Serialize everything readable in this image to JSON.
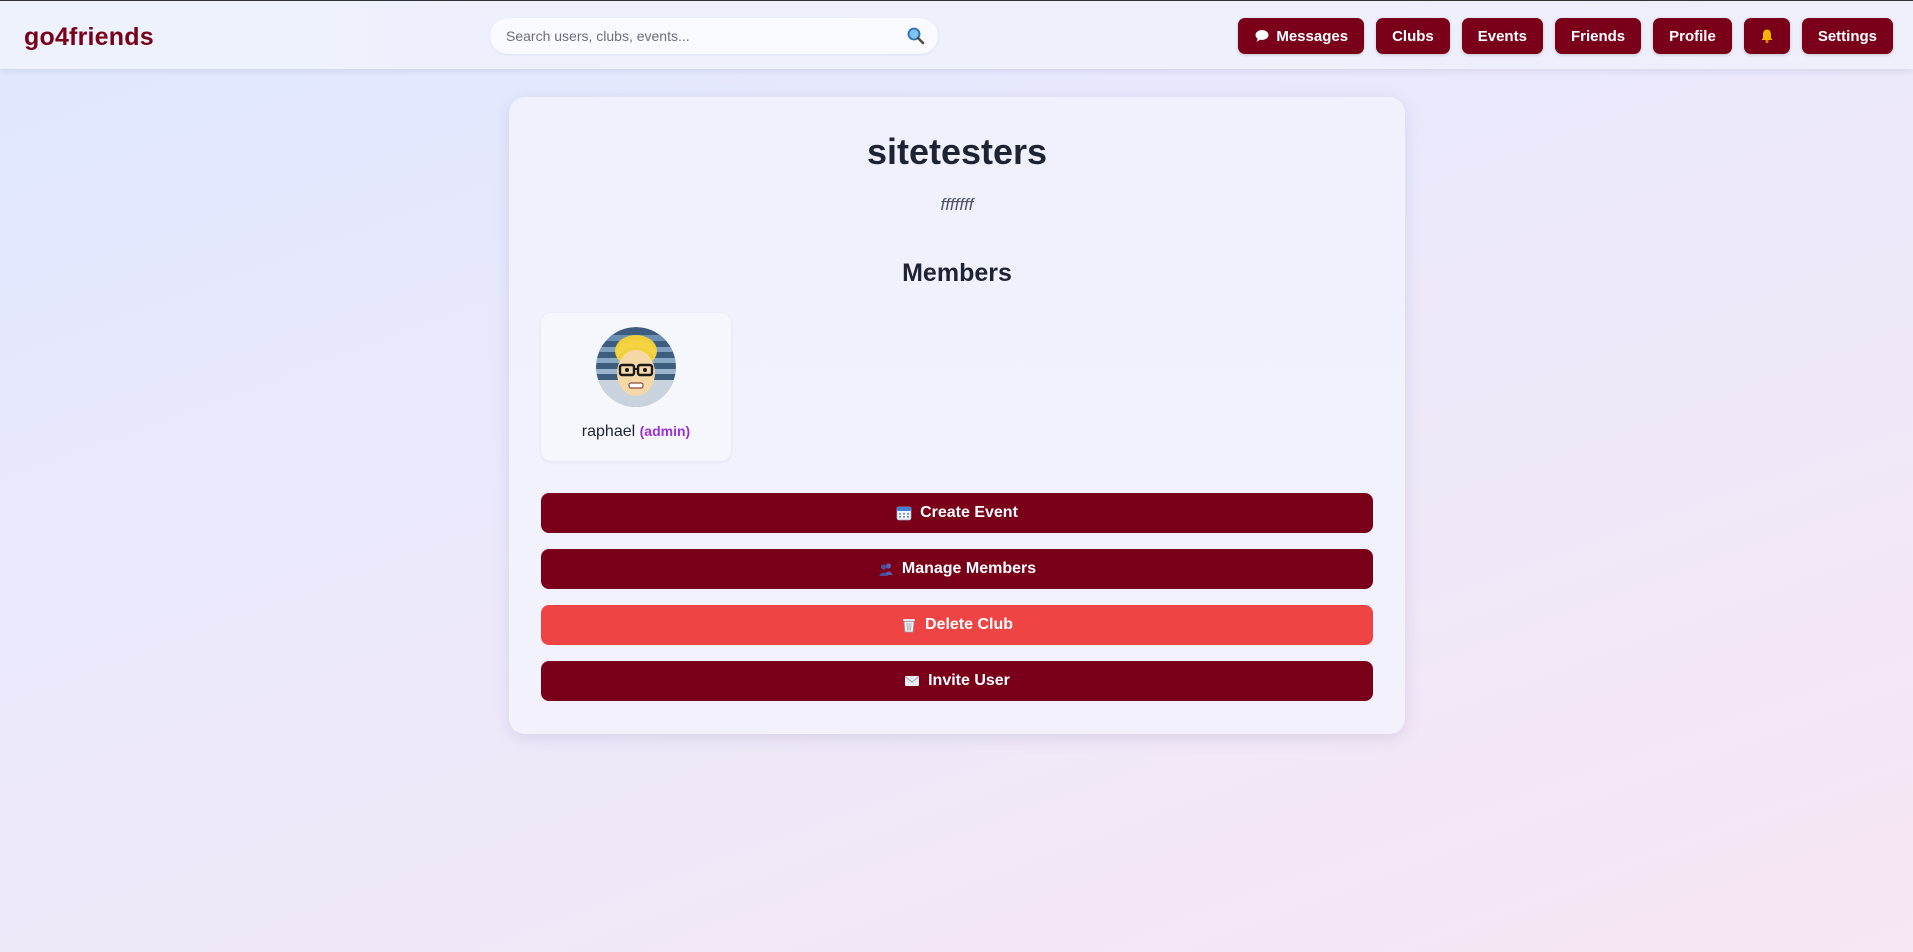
{
  "header": {
    "brand": "go4friends",
    "search_placeholder": "Search users, clubs, events...",
    "nav": [
      {
        "label": "Messages",
        "icon": "speech-bubble-icon"
      },
      {
        "label": "Clubs"
      },
      {
        "label": "Events"
      },
      {
        "label": "Friends"
      },
      {
        "label": "Profile"
      },
      {
        "label": "",
        "icon": "bell-icon"
      },
      {
        "label": "Settings"
      }
    ]
  },
  "club": {
    "name": "sitetesters",
    "description": "fffffff",
    "members_heading": "Members",
    "members": [
      {
        "name": "raphael",
        "role": "(admin)",
        "avatar": "memoji-avatar"
      }
    ]
  },
  "actions": [
    {
      "label": "Create Event",
      "icon": "calendar-icon",
      "variant": "primary"
    },
    {
      "label": "Manage Members",
      "icon": "people-icon",
      "variant": "primary"
    },
    {
      "label": "Delete Club",
      "icon": "wastebasket-icon",
      "variant": "danger"
    },
    {
      "label": "Invite User",
      "icon": "envelope-icon",
      "variant": "primary"
    }
  ],
  "colors": {
    "brand": "#7a0019",
    "danger": "#ef4444",
    "admin_role": "#9b32d6"
  }
}
